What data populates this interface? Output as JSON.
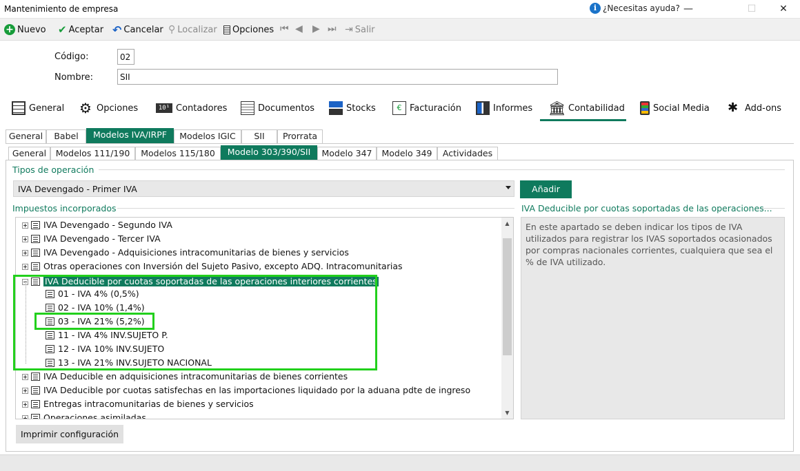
{
  "window": {
    "title": "Mantenimiento de empresa",
    "help": "¿Necesitas ayuda?",
    "minimize": "—",
    "maximize": "☐",
    "close": "✕"
  },
  "toolbar": {
    "nuevo": "Nuevo",
    "aceptar": "Aceptar",
    "cancelar": "Cancelar",
    "localizar": "Localizar",
    "opciones": "Opciones",
    "salir": "Salir"
  },
  "form": {
    "codigo_label": "Código:",
    "codigo_value": "02",
    "nombre_label": "Nombre:",
    "nombre_value": "SII"
  },
  "main_tabs": [
    "General",
    "Opciones",
    "Contadores",
    "Documentos",
    "Stocks",
    "Facturación",
    "Informes",
    "Contabilidad",
    "Social Media",
    "Add-ons"
  ],
  "main_tab_active": "Contabilidad",
  "sub_tabs_1": [
    "General",
    "Babel",
    "Modelos IVA/IRPF",
    "Modelos IGIC",
    "SII",
    "Prorrata"
  ],
  "sub_tabs_2": [
    "General",
    "Modelos 111/190",
    "Modelos 115/180",
    "Modelo 303/390/SII",
    "Modelo 347",
    "Modelo 349",
    "Actividades"
  ],
  "tipos": {
    "title": "Tipos de operación",
    "selected": "IVA Devengado - Primer IVA",
    "add_label": "Añadir"
  },
  "impuestos": {
    "title": "Impuestos incorporados",
    "rows": [
      "IVA Devengado - Segundo IVA",
      "IVA Devengado - Tercer IVA",
      "IVA Devengado - Adquisiciones intracomunitarias de bienes y servicios",
      "Otras operaciones con Inversión del Sujeto Pasivo, excepto ADQ. Intracomunitarias",
      "IVA Deducible por cuotas soportadas de las operaciones interiores corrientes",
      "01 - IVA 4% (0,5%)",
      "02 - IVA 10% (1,4%)",
      "03 - IVA 21% (5,2%)",
      "11 - IVA 4% INV.SUJETO P.",
      "12 - IVA 10% INV.SUJETO",
      "13 - IVA 21% INV.SUJETO NACIONAL",
      "IVA Deducible en adquisiciones intracomunitarias de bienes corrientes",
      "IVA Deducible por cuotas satisfechas en las importaciones liquidado por la aduana pdte de ingreso",
      "Entregas intracomunitarias de bienes y servicios",
      "Operaciones asimiladas"
    ]
  },
  "description": {
    "title": "IVA Deducible por cuotas soportadas de las operaciones...",
    "text": "En este apartado se deben indicar los tipos de IVA utilizados para registrar los IVAS soportados ocasionados por compras nacionales corrientes, cualquiera que sea el % de IVA utilizado."
  },
  "print_label": "Imprimir configuración",
  "colors": {
    "accent": "#0f7a5d",
    "highlight_box": "#22d01c"
  }
}
